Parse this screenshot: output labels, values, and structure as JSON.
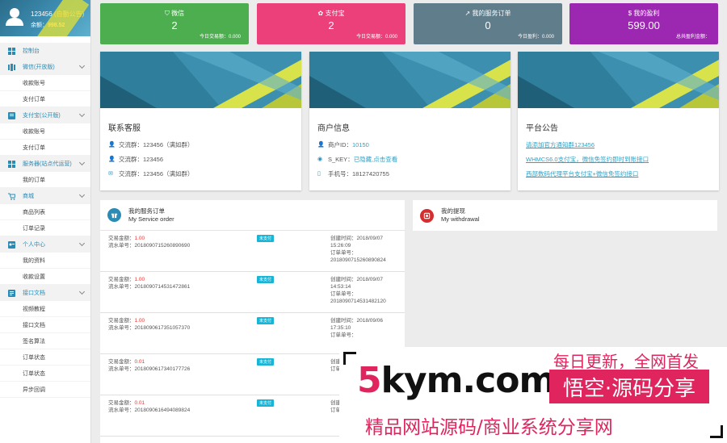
{
  "profile": {
    "name": "123456",
    "tag": "(自動公告)",
    "balance_label": "余额：",
    "balance": "998.52"
  },
  "sidebar": {
    "home": "控制台",
    "groups": [
      {
        "label": "微信(开放版)",
        "items": [
          "收款账号",
          "支付订单"
        ]
      },
      {
        "label": "支付宝(公开版)",
        "items": [
          "收款账号",
          "支付订单"
        ]
      },
      {
        "label": "服务器(站点代运营)",
        "items": [
          "我的订单"
        ]
      },
      {
        "label": "商城",
        "items": [
          "商品列表",
          "订单记录"
        ]
      },
      {
        "label": "个人中心",
        "items": [
          "我的资料",
          "收款设置"
        ]
      },
      {
        "label": "接口文档",
        "items": [
          "视频教程",
          "接口文档",
          "签名算法",
          "订单状态",
          "订单状态",
          "异步回调"
        ]
      }
    ]
  },
  "stats": [
    {
      "title": "微信",
      "value": "2",
      "sub": "今日交易额：0.000",
      "color": "#4cae4f"
    },
    {
      "title": "支付宝",
      "value": "2",
      "sub": "今日交易额：0.000",
      "color": "#ec407a"
    },
    {
      "title": "我的服务订单",
      "value": "0",
      "sub": "今日盈利：0.000",
      "color": "#607d8b"
    },
    {
      "title": "我的盈利",
      "value": "599.00",
      "sub": "总共盈利金额：",
      "color": "#9c27b0"
    }
  ],
  "cards": {
    "support": {
      "title": "联系客服",
      "lines": [
        "交流群：123456（满如群）",
        "交流群：123456",
        "交流群：123456（满如群）"
      ]
    },
    "merchant": {
      "title": "商户信息",
      "pid_label": "商户ID：",
      "pid": "10150",
      "key_label": "S_KEY：",
      "key": "已隐藏,点击查看",
      "phone_label": "手机号：",
      "phone": "18127420755"
    },
    "notice": {
      "title": "平台公告",
      "links": [
        "请添加官方通知群123456",
        "WHMCS6.0支付宝，微信免签约即时到账接口",
        "西部数码代理平台支付宝+微信免签约接口"
      ]
    }
  },
  "orders": {
    "title": "我的服务订单",
    "subtitle": "My Service order",
    "amount_label": "交易金额：",
    "serial_label": "流水单号：",
    "created_label": "创建时间：",
    "order_label": "订单单号：",
    "rows": [
      {
        "amount": "1.00",
        "serial": "2018090715260890690",
        "status": "未支付",
        "created": "2018/09/07 15:26:09",
        "order": "2018090715260890824"
      },
      {
        "amount": "1.00",
        "serial": "2018090714531472861",
        "status": "未支付",
        "created": "2018/09/07 14:53:14",
        "order": "2018090714531482120"
      },
      {
        "amount": "1.00",
        "serial": "2018090617351057370",
        "status": "未支付",
        "created": "2018/09/06 17:35:10",
        "order": ""
      },
      {
        "amount": "0.01",
        "serial": "2018090617340177726",
        "status": "未支付",
        "created": "",
        "order": ""
      },
      {
        "amount": "0.01",
        "serial": "2018090616494089824",
        "status": "未支付",
        "created": "",
        "order": ""
      }
    ]
  },
  "withdraw": {
    "title": "我的提现",
    "subtitle": "My withdrawal"
  },
  "watermark": {
    "top": "每日更新，全网首发",
    "logo_five": "5",
    "logo_rest": "kym.com",
    "pill": "悟空·源码分享",
    "bottom": "精品网站源码/商业系统分享网"
  },
  "colors": {
    "accent": "#2b8bb5",
    "badge": "#19b5d6",
    "amount_red": "#e53935",
    "watermark": "#e0245e"
  }
}
